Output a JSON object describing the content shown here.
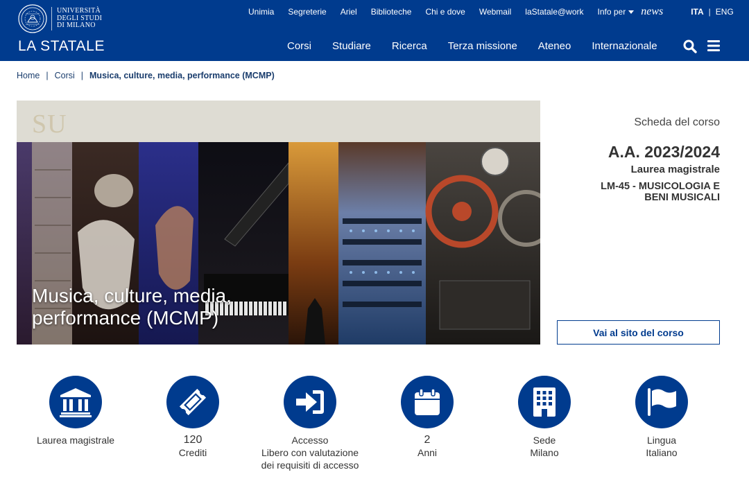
{
  "header": {
    "university_lines": [
      "UNIVERSITÀ",
      "DEGLI STUDI",
      "DI MILANO"
    ],
    "brand": "LA STATALE",
    "top_links": [
      "Unimia",
      "Segreterie",
      "Ariel",
      "Biblioteche",
      "Chi e dove",
      "Webmail",
      "laStatale@work"
    ],
    "info_per": "Info per",
    "news": "news",
    "lang_ita": "ITA",
    "lang_sep": "|",
    "lang_eng": "ENG",
    "nav": [
      "Corsi",
      "Studiare",
      "Ricerca",
      "Terza missione",
      "Ateneo",
      "Internazionale"
    ],
    "brand_color": "#003b8e"
  },
  "breadcrumb": {
    "home": "Home",
    "sep": "|",
    "corsi": "Corsi",
    "current": "Musica, culture, media, performance (MCMP)"
  },
  "hero": {
    "overlay": "SU",
    "title_line1": "Musica, culture, media,",
    "title_line2": "performance (MCMP)"
  },
  "course": {
    "scheda": "Scheda del corso",
    "anno": "A.A. 2023/2024",
    "tipo": "Laurea magistrale",
    "classe_line1": "LM-45 - MUSICOLOGIA E",
    "classe_line2": "BENI MUSICALI",
    "sito_button": "Vai al sito del corso"
  },
  "features": [
    {
      "icon": "university-building-icon",
      "lines": [
        "Laurea magistrale"
      ]
    },
    {
      "icon": "ticket-icon",
      "big": "120",
      "lines": [
        "Crediti"
      ]
    },
    {
      "icon": "sign-in-arrow-icon",
      "lines": [
        "Accesso",
        "Libero con valutazione",
        "dei requisiti di accesso"
      ]
    },
    {
      "icon": "calendar-icon",
      "big": "2",
      "lines": [
        "Anni"
      ]
    },
    {
      "icon": "building-icon",
      "lines": [
        "Sede",
        "Milano"
      ]
    },
    {
      "icon": "flag-icon",
      "lines": [
        "Lingua",
        "Italiano"
      ]
    }
  ]
}
